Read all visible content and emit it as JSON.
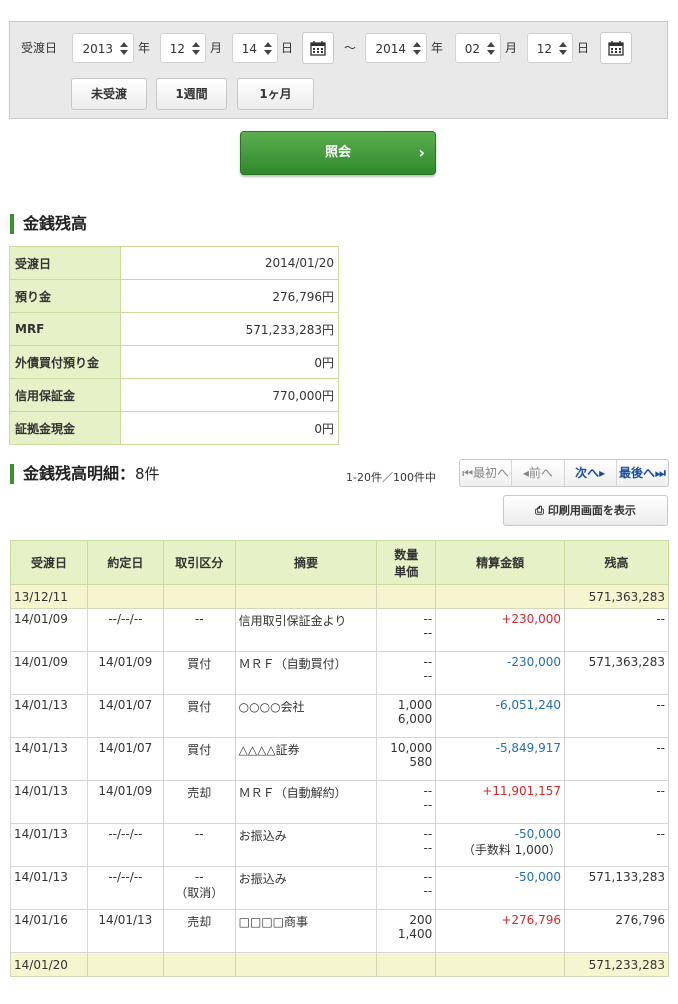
{
  "filter": {
    "label": "受渡日",
    "from": {
      "year": "2013",
      "month": "12",
      "day": "14"
    },
    "to": {
      "year": "2014",
      "month": "02",
      "day": "12"
    },
    "year_unit": "年",
    "month_unit": "月",
    "day_unit": "日",
    "tilde": "～",
    "quick_buttons": [
      "未受渡",
      "1週間",
      "1ヶ月"
    ],
    "search_label": "照会"
  },
  "balance": {
    "title": "金銭残高",
    "rows": [
      {
        "label": "受渡日",
        "value": "2014/01/20"
      },
      {
        "label": "預り金",
        "value": "276,796円"
      },
      {
        "label": "MRF",
        "value": "571,233,283円"
      },
      {
        "label": "外債買付預り金",
        "value": "0円"
      },
      {
        "label": "信用保証金",
        "value": "770,000円"
      },
      {
        "label": "証拠金現金",
        "value": "0円"
      }
    ]
  },
  "detail": {
    "title": "金銭残高明細：",
    "count": "8件",
    "range": "1-20件／100件中",
    "pager": {
      "first": "最初へ",
      "prev": "前へ",
      "next": "次へ",
      "last": "最後へ"
    },
    "print_label": "印刷用画面を表示",
    "headers": {
      "date": "受渡日",
      "trade_date": "約定日",
      "type": "取引区分",
      "summary": "摘要",
      "qty": "数量",
      "price": "単価",
      "amount": "精算金額",
      "balance": "残高"
    },
    "opening": {
      "date": "13/12/11",
      "balance": "571,363,283"
    },
    "rows": [
      {
        "date": "14/01/09",
        "trade": "--/--/--",
        "type": "--",
        "type2": "",
        "summary": "信用取引保証金より",
        "qty": "--",
        "price": "--",
        "amount": "+230,000",
        "sign": "plus",
        "fee": "",
        "balance": "--"
      },
      {
        "date": "14/01/09",
        "trade": "14/01/09",
        "type": "買付",
        "type2": "",
        "summary": "ＭＲＦ（自動買付）",
        "qty": "--",
        "price": "--",
        "amount": "-230,000",
        "sign": "minus",
        "fee": "",
        "balance": "571,363,283"
      },
      {
        "date": "14/01/13",
        "trade": "14/01/07",
        "type": "買付",
        "type2": "",
        "summary": "○○○○会社",
        "qty": "1,000",
        "price": "6,000",
        "amount": "-6,051,240",
        "sign": "minus",
        "fee": "",
        "balance": "--"
      },
      {
        "date": "14/01/13",
        "trade": "14/01/07",
        "type": "買付",
        "type2": "",
        "summary": "△△△△証券",
        "qty": "10,000",
        "price": "580",
        "amount": "-5,849,917",
        "sign": "minus",
        "fee": "",
        "balance": "--"
      },
      {
        "date": "14/01/13",
        "trade": "14/01/09",
        "type": "売却",
        "type2": "",
        "summary": "ＭＲＦ（自動解約）",
        "qty": "--",
        "price": "--",
        "amount": "+11,901,157",
        "sign": "plus",
        "fee": "",
        "balance": "--"
      },
      {
        "date": "14/01/13",
        "trade": "--/--/--",
        "type": "--",
        "type2": "",
        "summary": "お振込み",
        "qty": "--",
        "price": "--",
        "amount": "-50,000",
        "sign": "minus",
        "fee": "（手数料 1,000）",
        "balance": "--"
      },
      {
        "date": "14/01/13",
        "trade": "--/--/--",
        "type": "--",
        "type2": "（取消）",
        "summary": "お振込み",
        "qty": "--",
        "price": "--",
        "amount": "-50,000",
        "sign": "minus",
        "fee": "",
        "balance": "571,133,283"
      },
      {
        "date": "14/01/16",
        "trade": "14/01/13",
        "type": "売却",
        "type2": "",
        "summary": "□□□□商事",
        "qty": "200",
        "price": "1,400",
        "amount": "+276,796",
        "sign": "plus",
        "fee": "",
        "balance": "276,796"
      }
    ],
    "closing": {
      "date": "14/01/20",
      "balance": "571,233,283"
    }
  }
}
